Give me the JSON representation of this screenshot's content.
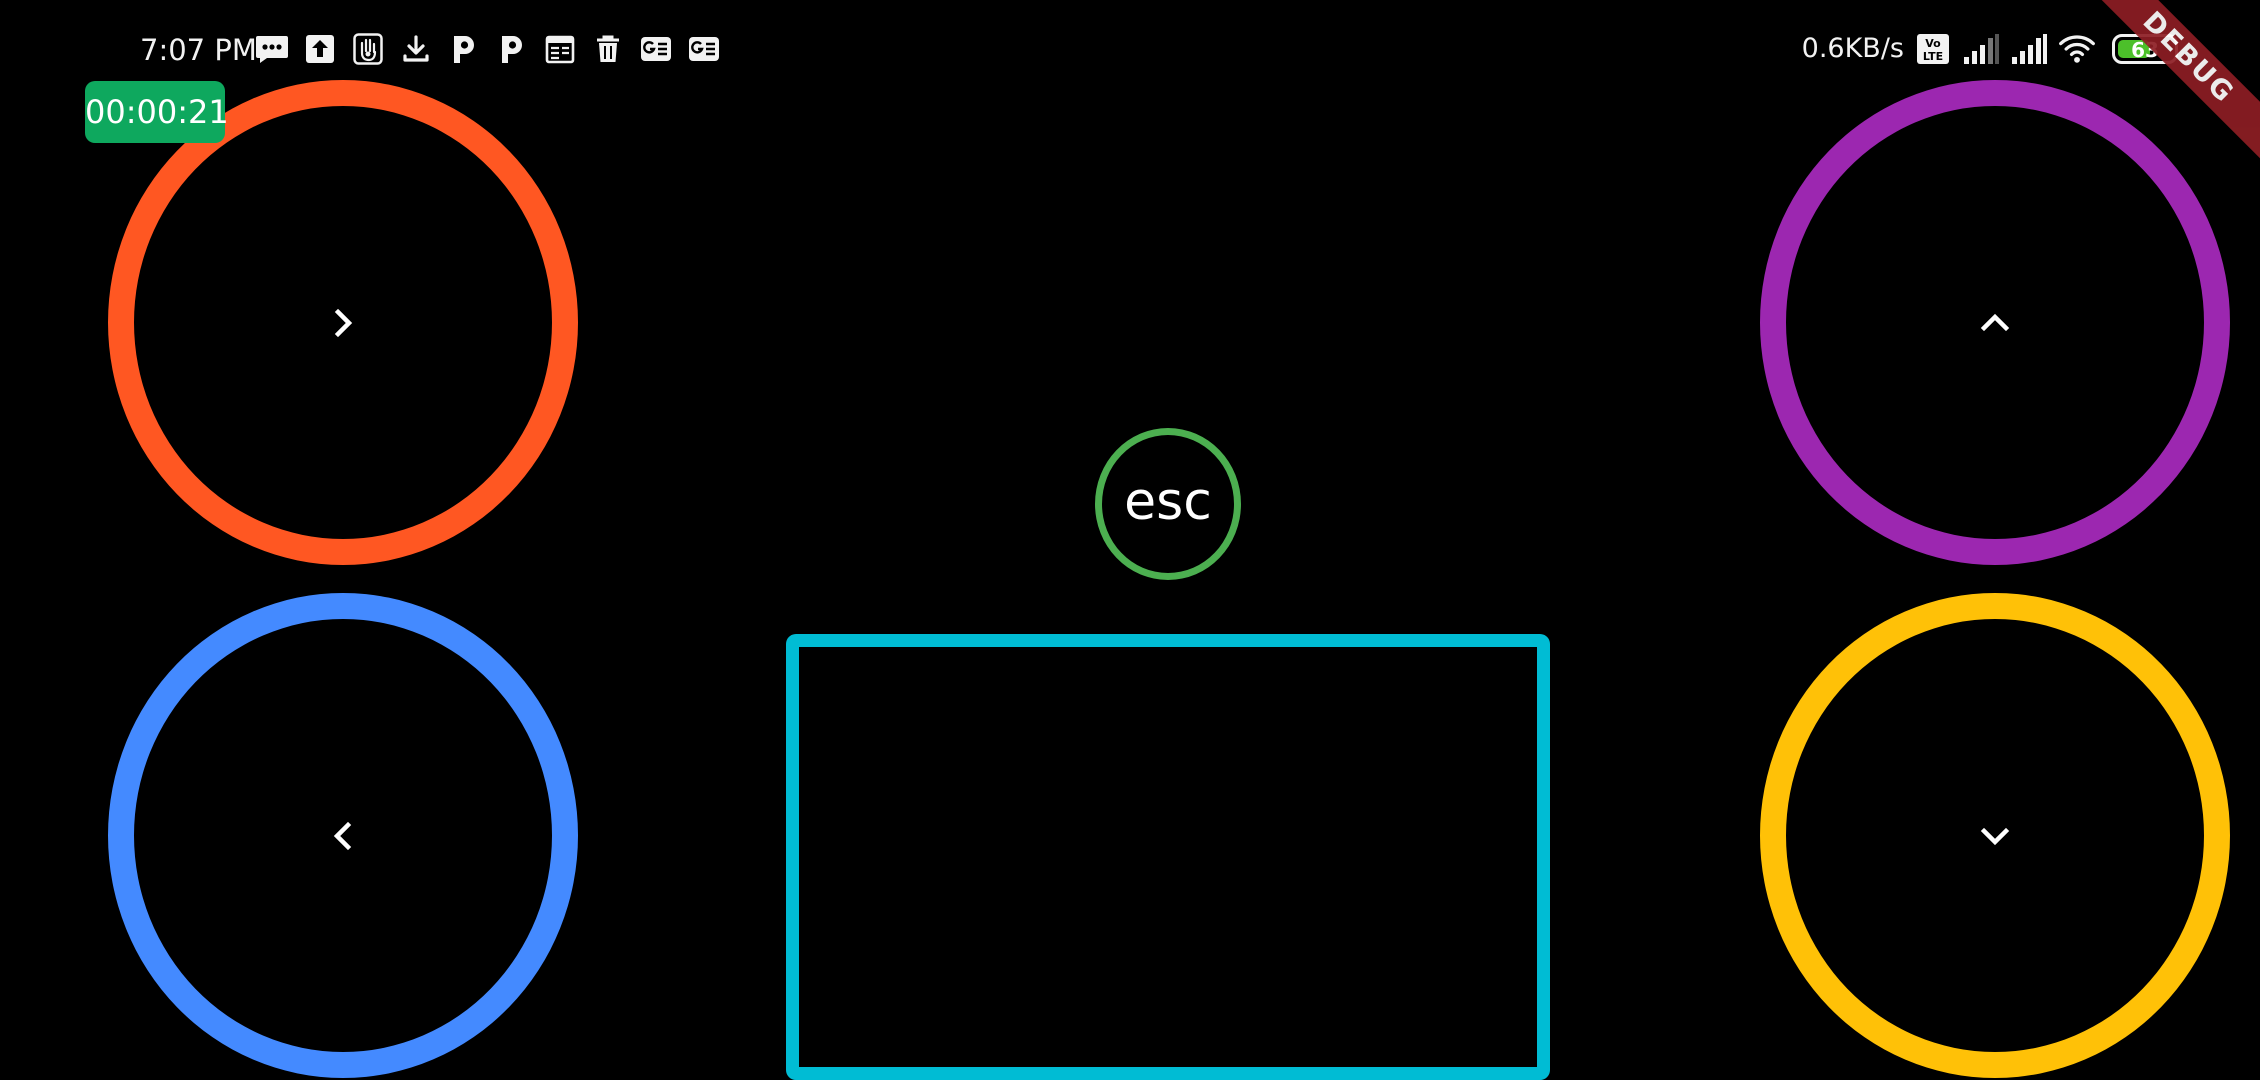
{
  "status_bar": {
    "time": "7:07 PM",
    "notification_icons": [
      "message-dots-icon",
      "upload-arrow-icon",
      "hand-icon",
      "download-arrow-icon",
      "p-app-icon",
      "p-app-icon",
      "calendar-icon",
      "trash-icon",
      "g-news-icon",
      "g-news-icon"
    ],
    "net_speed": "0.6KB/s",
    "volte_icon": "volte-icon",
    "signal_icons": [
      "signal-icon",
      "signal-icon"
    ],
    "wifi_icon": "wifi-icon",
    "battery_level": 63,
    "battery_text": "63",
    "battery_color": "#4cc02a"
  },
  "debug_banner": "DEBUG",
  "timer": "00:00:21",
  "controls": {
    "right": {
      "icon": "chevron-right-icon",
      "color": "#ff5722"
    },
    "left": {
      "icon": "chevron-left-icon",
      "color": "#448aff"
    },
    "up": {
      "icon": "chevron-up-icon",
      "color": "#9c27b0"
    },
    "down": {
      "icon": "chevron-down-icon",
      "color": "#ffc107"
    },
    "esc": {
      "label": "esc",
      "color": "#4caf50"
    },
    "touchpad": {
      "color": "#00bcd4"
    }
  }
}
